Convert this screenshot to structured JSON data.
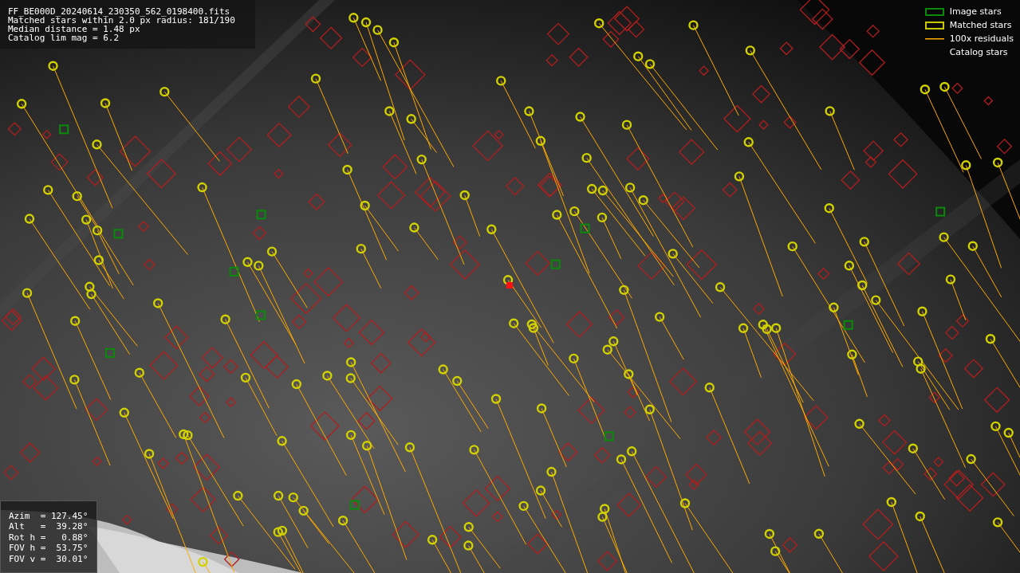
{
  "file_info": {
    "lines": [
      "FF_BE000D_20240614_230350_562_0198400.fits",
      "Matched stars within 2.0 px radius: 181/190",
      "Median distance = 1.48 px",
      "Catalog lim mag = 6.2"
    ]
  },
  "legend": [
    {
      "label": "Image stars"
    },
    {
      "label": "Matched stars",
      "kind": "matched"
    },
    {
      "label": "100x residuals",
      "kind": "residual"
    },
    {
      "label": "Catalog stars",
      "kind": "catalog"
    }
  ],
  "pointing": {
    "rows": [
      "Azim  = 127.45°",
      "Alt   =  39.28°",
      "Rot h =   0.88°",
      "FOV h =  53.75°",
      "FOV v =  30.01°"
    ]
  }
}
